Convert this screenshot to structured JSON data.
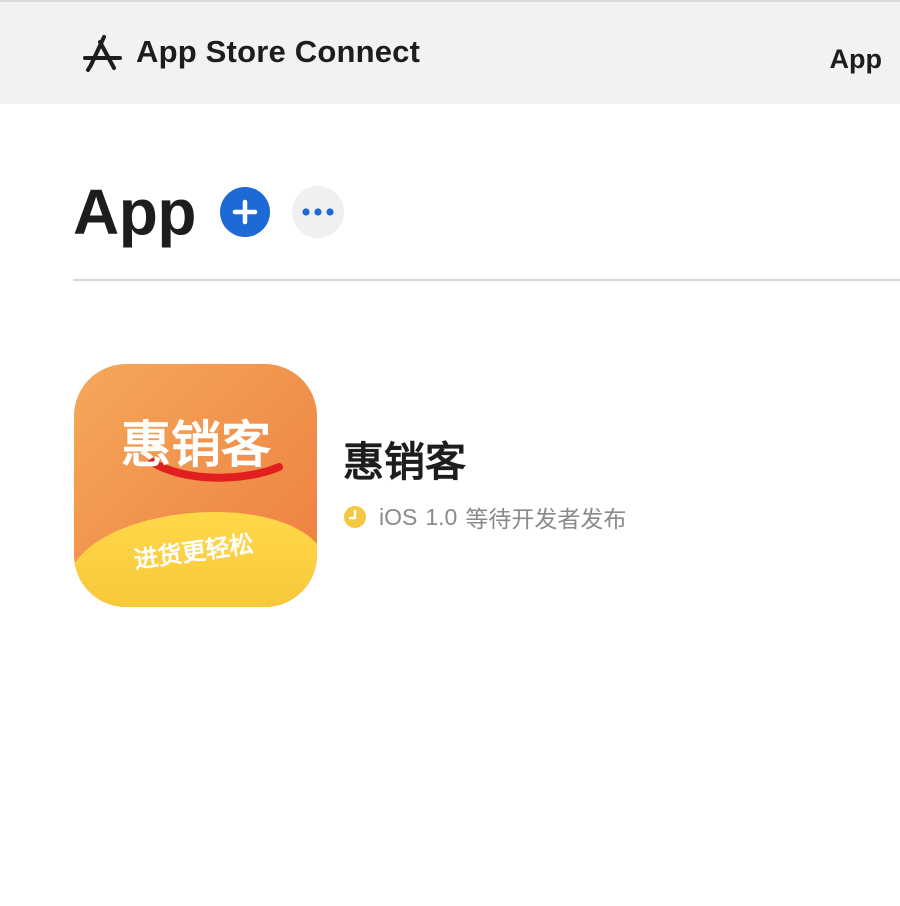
{
  "header": {
    "brand_name": "App Store Connect",
    "brand_icon": "app-store-icon",
    "nav_apps_label": "App"
  },
  "page": {
    "title": "App",
    "add_icon": "plus-icon",
    "more_icon": "ellipsis-icon",
    "accent_color": "#1d6ad6"
  },
  "apps": [
    {
      "name": "惠销客",
      "icon_title": "惠销客",
      "icon_tagline": "进货更轻松",
      "platform": "iOS",
      "version": "1.0",
      "status": "等待开发者发布",
      "status_icon": "clock-icon",
      "status_color": "#f5c842"
    }
  ]
}
